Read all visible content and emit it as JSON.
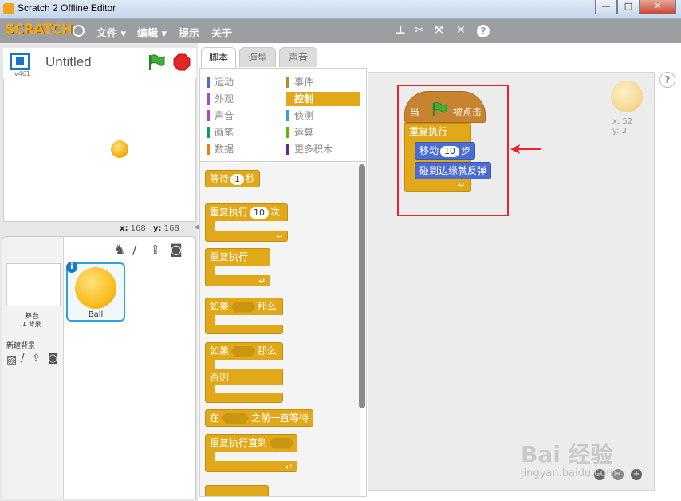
{
  "window": {
    "title": "Scratch 2 Offline Editor",
    "min": "—",
    "max": "□",
    "close": "✕"
  },
  "menubar": {
    "logo": "SCRATCH",
    "file": "文件 ▾",
    "edit": "编辑 ▾",
    "tips": "提示",
    "about": "关于"
  },
  "stage": {
    "version": "v461",
    "project_title": "Untitled",
    "mouse_x_label": "x:",
    "mouse_x": "168",
    "mouse_y_label": "y:",
    "mouse_y": "168"
  },
  "sprites": {
    "stage_label": "舞台",
    "stage_backdrops": "1 背景",
    "new_backdrop": "新建背景",
    "sprite_name": "Ball"
  },
  "tabs": [
    "脚本",
    "造型",
    "声音"
  ],
  "categories": [
    {
      "label": "运动",
      "color": "#4a6cd4"
    },
    {
      "label": "事件",
      "color": "#c88330"
    },
    {
      "label": "外观",
      "color": "#8a55d7"
    },
    {
      "label": "控制",
      "color": "#e1a91a"
    },
    {
      "label": "声音",
      "color": "#bb42c3"
    },
    {
      "label": "侦测",
      "color": "#2ca5e2"
    },
    {
      "label": "画笔",
      "color": "#0e9a6c"
    },
    {
      "label": "运算",
      "color": "#5cb712"
    },
    {
      "label": "数据",
      "color": "#ee7d16"
    },
    {
      "label": "更多积木",
      "color": "#632d99"
    }
  ],
  "palette_blocks": {
    "wait": "等待",
    "wait_num": "1",
    "wait_unit": "秒",
    "repeat": "重复执行",
    "repeat_num": "10",
    "repeat_unit": "次",
    "forever": "重复执行",
    "if": "如果",
    "then": "那么",
    "if2": "如果",
    "then2": "那么",
    "else": "否则",
    "wait_until": "在",
    "wait_until_suffix": "之前一直等待",
    "repeat_until": "重复执行直到"
  },
  "script": {
    "when": "当",
    "clicked": "被点击",
    "forever": "重复执行",
    "move": "移动",
    "move_num": "10",
    "move_unit": "步",
    "bounce": "碰到边缘就反弹"
  },
  "sprite_info": {
    "x_label": "x:",
    "x": "52",
    "y_label": "y:",
    "y": "2"
  },
  "watermark": {
    "brand": "Bai 经验",
    "url": "jingyan.baidu.com"
  }
}
